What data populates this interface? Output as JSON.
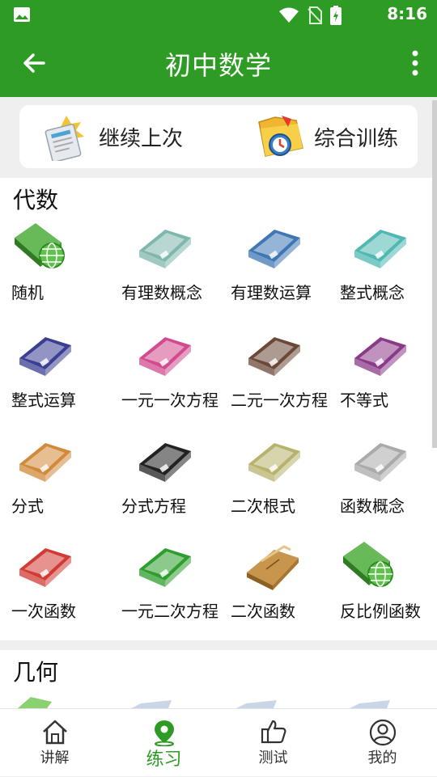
{
  "status": {
    "time": "8:16"
  },
  "appbar": {
    "title": "初中数学"
  },
  "quick": {
    "continue_label": "继续上次",
    "train_label": "综合训练"
  },
  "sections": [
    {
      "title": "代数",
      "items": [
        {
          "label": "随机",
          "icon": "random-globe-icon",
          "color": "#4cae3a"
        },
        {
          "label": "有理数概念",
          "icon": "book-icon",
          "color": "#7fb7ad"
        },
        {
          "label": "有理数运算",
          "icon": "book-icon",
          "color": "#3f77b5"
        },
        {
          "label": "整式概念",
          "icon": "book-icon",
          "color": "#4fb8b2"
        },
        {
          "label": "整式运算",
          "icon": "book-icon",
          "color": "#3a3f92"
        },
        {
          "label": "一元一次方程",
          "icon": "book-icon",
          "color": "#d24b8e"
        },
        {
          "label": "二元一次方程",
          "icon": "book-icon",
          "color": "#6b4938"
        },
        {
          "label": "不等式",
          "icon": "book-icon",
          "color": "#8a3b88"
        },
        {
          "label": "分式",
          "icon": "book-icon",
          "color": "#d1893a"
        },
        {
          "label": "分式方程",
          "icon": "book-icon",
          "color": "#222222"
        },
        {
          "label": "二次根式",
          "icon": "book-icon",
          "color": "#b7b36c"
        },
        {
          "label": "函数概念",
          "icon": "book-icon",
          "color": "#aaaaaa"
        },
        {
          "label": "一次函数",
          "icon": "book-icon",
          "color": "#d13b35"
        },
        {
          "label": "一元二次方程",
          "icon": "book-icon",
          "color": "#2e9e2e"
        },
        {
          "label": "二次函数",
          "icon": "folder-book-icon",
          "color": "#c7964c"
        },
        {
          "label": "反比例函数",
          "icon": "random-globe-icon",
          "color": "#4cae3a"
        }
      ]
    },
    {
      "title": "几何"
    }
  ],
  "nav": [
    {
      "label": "讲解",
      "icon": "home-icon"
    },
    {
      "label": "练习",
      "icon": "location-pin-icon",
      "active": true
    },
    {
      "label": "测试",
      "icon": "thumbs-up-icon"
    },
    {
      "label": "我的",
      "icon": "user-icon"
    }
  ],
  "colors": {
    "brand": "#2e9b24",
    "background": "#efefef"
  }
}
